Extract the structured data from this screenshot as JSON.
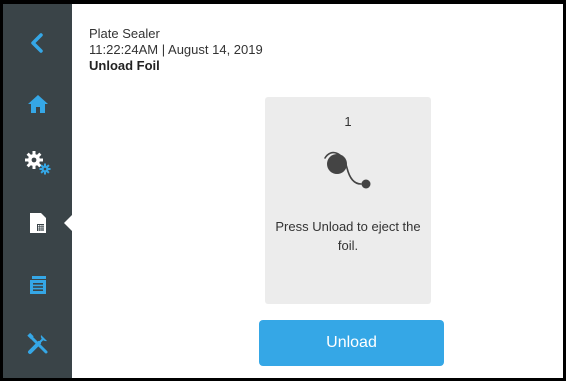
{
  "header": {
    "device_name": "Plate Sealer",
    "datetime": "11:22:24AM | August 14, 2019",
    "screen_title": "Unload Foil"
  },
  "sidebar": {
    "items": [
      {
        "icon": "back-arrow-icon",
        "active": false
      },
      {
        "icon": "home-icon",
        "active": false
      },
      {
        "icon": "gears-icon",
        "active": false
      },
      {
        "icon": "plate-icon",
        "active": true
      },
      {
        "icon": "protocols-icon",
        "active": false
      },
      {
        "icon": "tools-icon",
        "active": false
      }
    ]
  },
  "step": {
    "number": "1",
    "instruction": "Press Unload to eject the foil.",
    "icon": "foil-roll-icon"
  },
  "actions": {
    "unload_label": "Unload"
  },
  "colors": {
    "sidebar_bg": "#3a4448",
    "icon_blue": "#35a7e6",
    "card_bg": "#ececec",
    "button_bg": "#35a7e6"
  }
}
